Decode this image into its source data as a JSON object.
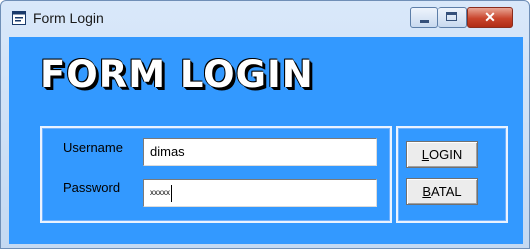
{
  "window": {
    "title": "Form Login",
    "icon": "form-window-icon"
  },
  "form": {
    "heading": "FORM LOGIN",
    "username": {
      "label": "Username",
      "value": "dimas"
    },
    "password": {
      "label": "Password",
      "value": "xxxxx"
    }
  },
  "buttons": {
    "login": {
      "mnemonic": "L",
      "rest": "OGIN"
    },
    "batal": {
      "mnemonic": "B",
      "rest": "ATAL"
    }
  },
  "colors": {
    "client_background": "#3399ff",
    "group_border": "#eaf3ff"
  }
}
